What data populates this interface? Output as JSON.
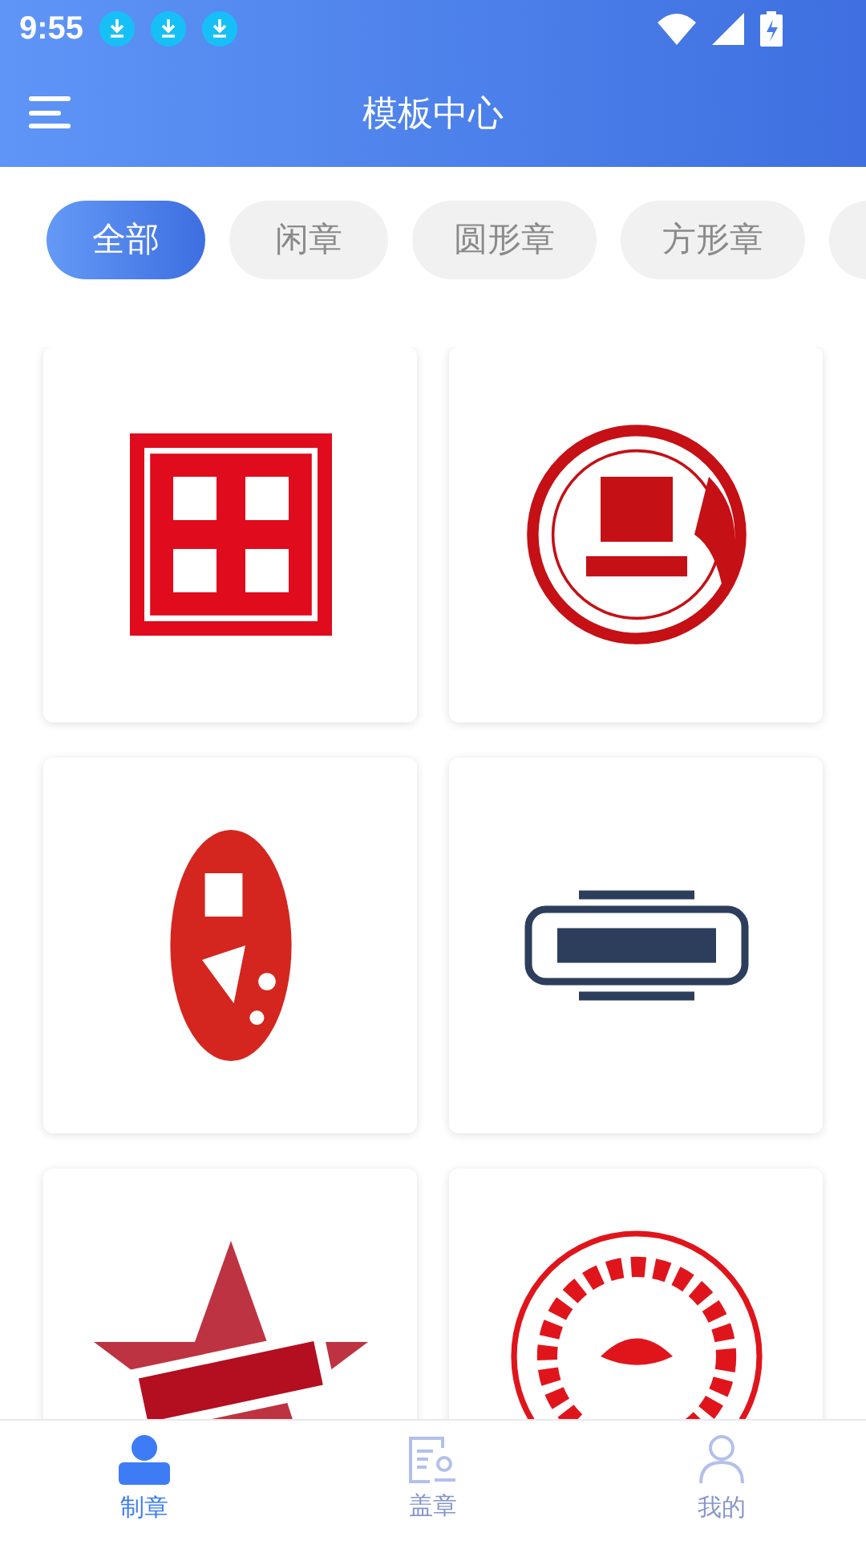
{
  "status_bar": {
    "time": "9:55",
    "notifications": [
      {
        "kind": "download"
      },
      {
        "kind": "download"
      },
      {
        "kind": "download"
      }
    ]
  },
  "header": {
    "title": "模板中心"
  },
  "tabs": [
    {
      "label": "全部",
      "selected": true
    },
    {
      "label": "闲章",
      "selected": false
    },
    {
      "label": "圆形章",
      "selected": false
    },
    {
      "label": "方形章",
      "selected": false
    },
    {
      "selected": false
    }
  ],
  "bottom_nav": [
    {
      "label": "制章",
      "kind": "stamp",
      "selected": true
    },
    {
      "label": "盖章",
      "kind": "document",
      "selected": false
    },
    {
      "label": "我的",
      "kind": "person",
      "selected": false
    }
  ]
}
